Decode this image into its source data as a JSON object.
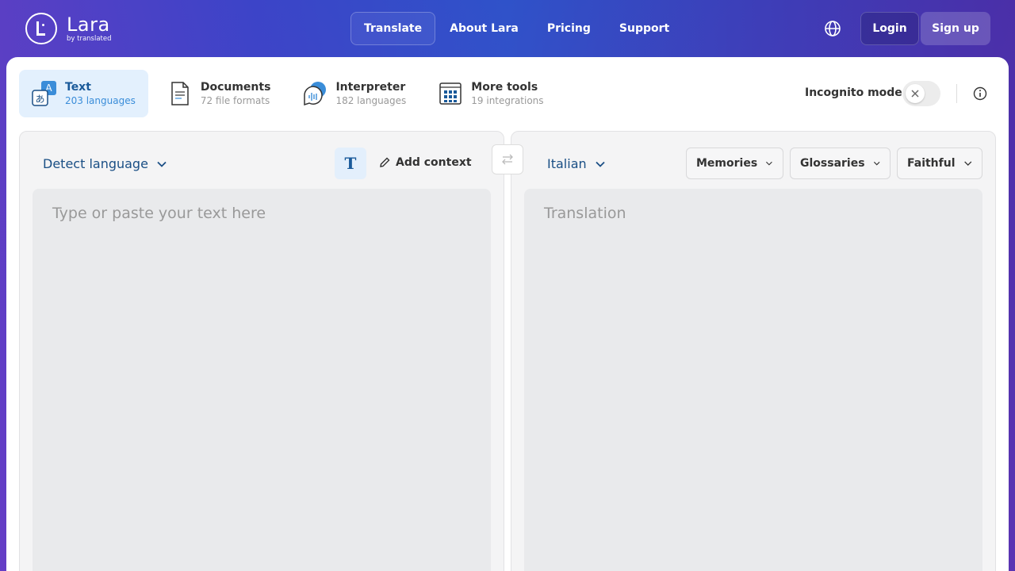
{
  "header": {
    "logo_name": "Lara",
    "logo_sub": "by translated",
    "nav": [
      {
        "label": "Translate"
      },
      {
        "label": "About Lara"
      },
      {
        "label": "Pricing"
      },
      {
        "label": "Support"
      }
    ],
    "login_label": "Login",
    "signup_label": "Sign up"
  },
  "tabs": [
    {
      "title": "Text",
      "sub": "203 languages",
      "icon": "text-translate-icon"
    },
    {
      "title": "Documents",
      "sub": "72 file formats",
      "icon": "document-icon"
    },
    {
      "title": "Interpreter",
      "sub": "182 languages",
      "icon": "interpreter-icon"
    },
    {
      "title": "More tools",
      "sub": "19 integrations",
      "icon": "grid-icon"
    }
  ],
  "incognito": {
    "label": "Incognito mode",
    "enabled": false
  },
  "source": {
    "language": "Detect language",
    "add_context_label": "Add context",
    "placeholder": "Type or paste your text here"
  },
  "target": {
    "language": "Italian",
    "memories_label": "Memories",
    "glossaries_label": "Glossaries",
    "style_label": "Faithful",
    "placeholder": "Translation"
  },
  "colors": {
    "accent": "#1a5a9a",
    "active_tab_bg": "#e3f0fd"
  }
}
